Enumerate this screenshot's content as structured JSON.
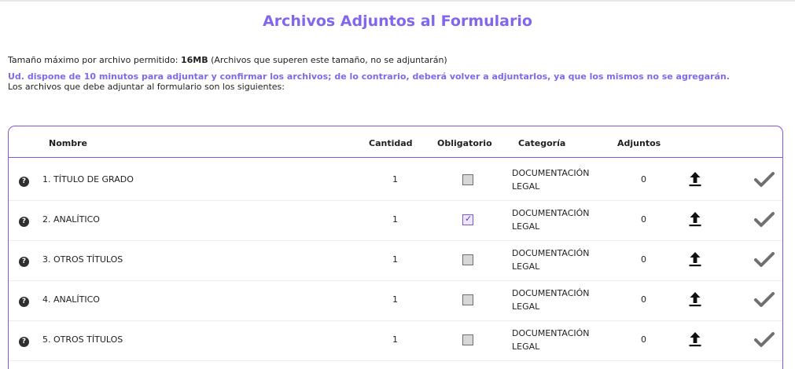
{
  "page": {
    "title": "Archivos Adjuntos al Formulario",
    "size_text_prefix": "Tamaño máximo por archivo permitido: ",
    "size_limit": "16MB",
    "size_text_suffix": " (Archivos que superen este tamaño, no se adjuntarán)",
    "warning": "Ud. dispone de 10 minutos para adjuntar y confirmar los archivos; de lo contrario, deberá volver a adjuntarlos, ya que los mismos no se agregarán.",
    "intro": "Los archivos que debe adjuntar al formulario son los siguientes:"
  },
  "table": {
    "headers": {
      "name": "Nombre",
      "quantity": "Cantidad",
      "required": "Obligatorio",
      "category": "Categoría",
      "attachments": "Adjuntos"
    },
    "rows": [
      {
        "name": "1. TÍTULO DE GRADO",
        "quantity": "1",
        "required": false,
        "category_line1": "DOCUMENTACIÓN",
        "category_line2": "LEGAL",
        "attachments": "0"
      },
      {
        "name": "2. ANALÍTICO",
        "quantity": "1",
        "required": true,
        "category_line1": "DOCUMENTACIÓN",
        "category_line2": "LEGAL",
        "attachments": "0"
      },
      {
        "name": "3. OTROS TÍTULOS",
        "quantity": "1",
        "required": false,
        "category_line1": "DOCUMENTACIÓN",
        "category_line2": "LEGAL",
        "attachments": "0"
      },
      {
        "name": "4. ANALÍTICO",
        "quantity": "1",
        "required": false,
        "category_line1": "DOCUMENTACIÓN",
        "category_line2": "LEGAL",
        "attachments": "0"
      },
      {
        "name": "5. OTROS TÍTULOS",
        "quantity": "1",
        "required": false,
        "category_line1": "DOCUMENTACIÓN",
        "category_line2": "LEGAL",
        "attachments": "0"
      }
    ]
  },
  "colors": {
    "accent": "#8167ee",
    "border": "#7f58d6",
    "checkmark": "#707070"
  },
  "icons": {
    "help": "question-circle-icon",
    "upload": "upload-icon",
    "confirm": "check-icon"
  }
}
